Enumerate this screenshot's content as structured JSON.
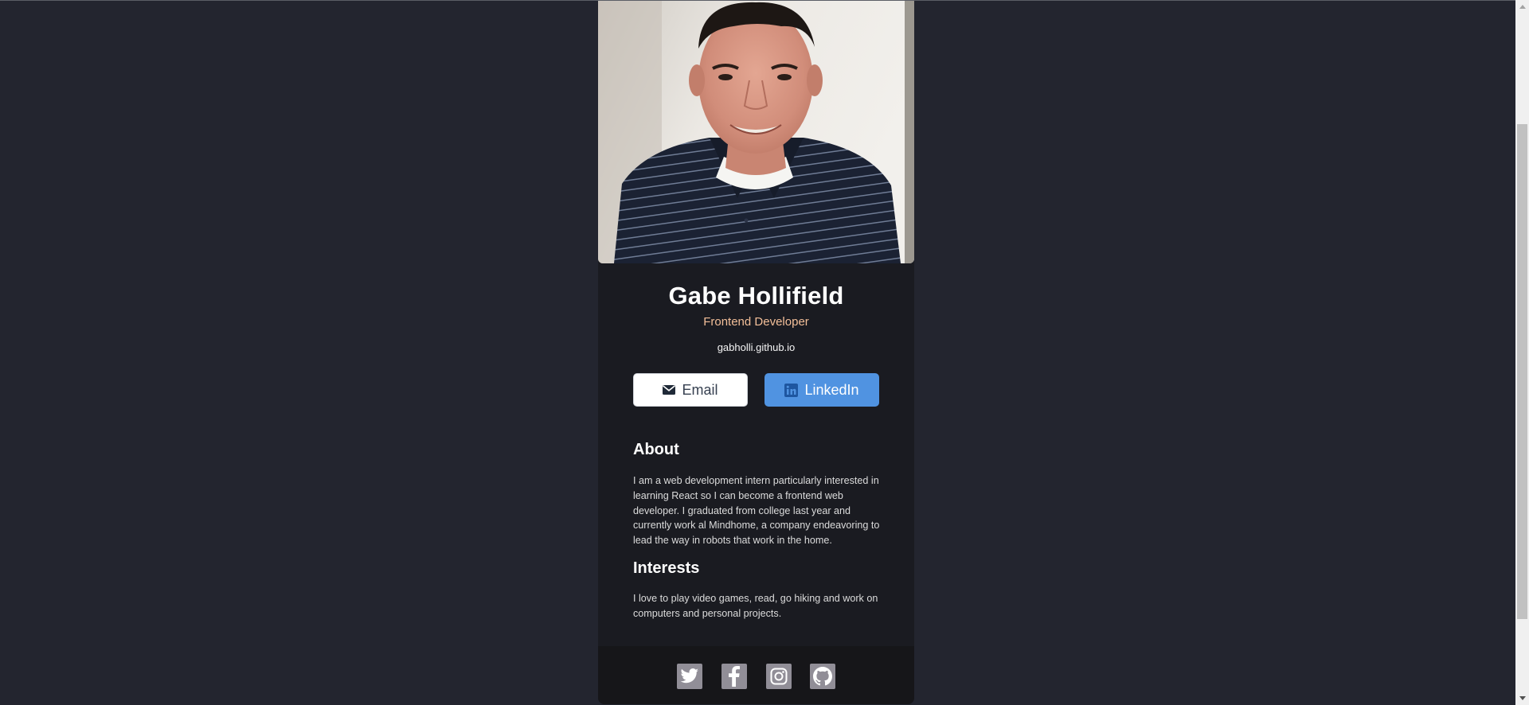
{
  "profile": {
    "name": "Gabe Hollifield",
    "role": "Frontend Developer",
    "website": "gabholli.github.io"
  },
  "buttons": {
    "email_label": "Email",
    "linkedin_label": "LinkedIn"
  },
  "about": {
    "title": "About",
    "text": "I am a web development intern particularly interested in learning React so I can become a frontend web developer. I graduated from college last year and currently work al Mindhome, a company endeavoring to lead the way in robots that work in the home."
  },
  "interests": {
    "title": "Interests",
    "text": "I love to play video games, read, go hiking and work on computers and personal projects."
  },
  "footer": {
    "icons": [
      "twitter-icon",
      "facebook-icon",
      "instagram-icon",
      "github-icon"
    ]
  },
  "colors": {
    "page_background": "#23252f",
    "card_background": "#1a1b21",
    "footer_background": "#161619",
    "role_color": "#f3bf99",
    "linkedin_button": "#5093e1",
    "social_icon_bg": "#918e97"
  }
}
